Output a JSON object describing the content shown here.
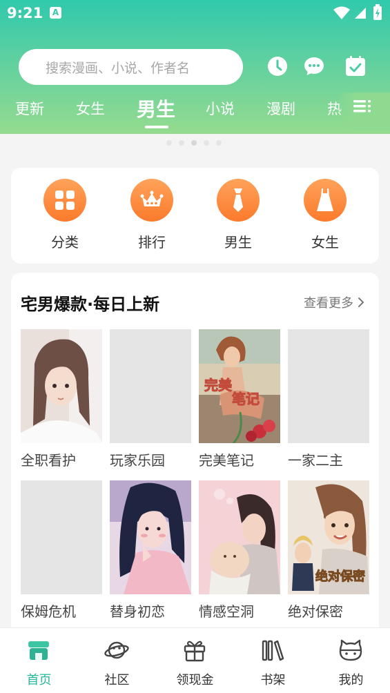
{
  "status_bar": {
    "time": "9:21",
    "notification_badge": "A"
  },
  "search": {
    "placeholder": "搜索漫画、小说、作者名"
  },
  "header_icons": [
    "clock-icon",
    "chat-icon",
    "checkin-icon"
  ],
  "tabs": [
    {
      "label": "更新",
      "active": false
    },
    {
      "label": "女生",
      "active": false
    },
    {
      "label": "男生",
      "active": true
    },
    {
      "label": "小说",
      "active": false
    },
    {
      "label": "漫剧",
      "active": false
    },
    {
      "label": "热",
      "active": false
    }
  ],
  "carousel": {
    "count": 5,
    "active_index": 2
  },
  "quick_entries": [
    {
      "label": "分类",
      "icon": "grid-icon"
    },
    {
      "label": "排行",
      "icon": "crown-icon"
    },
    {
      "label": "男生",
      "icon": "tie-icon"
    },
    {
      "label": "女生",
      "icon": "dress-icon"
    }
  ],
  "section": {
    "title": "宅男爆款·每日上新",
    "more_label": "查看更多",
    "books": [
      {
        "title": "全职看护"
      },
      {
        "title": "玩家乐园"
      },
      {
        "title": "完美笔记"
      },
      {
        "title": "一家二主"
      },
      {
        "title": "保姆危机"
      },
      {
        "title": "替身初恋"
      },
      {
        "title": "情感空洞"
      },
      {
        "title": "绝对保密"
      }
    ]
  },
  "bottom_nav": [
    {
      "label": "首页",
      "active": true
    },
    {
      "label": "社区",
      "active": false
    },
    {
      "label": "领现金",
      "active": false
    },
    {
      "label": "书架",
      "active": false
    },
    {
      "label": "我的",
      "active": false
    }
  ],
  "colors": {
    "accent": "#25b99a",
    "header_top": "#30c9ac",
    "header_bottom": "#95db8f",
    "orange": "#fb7a2c"
  }
}
